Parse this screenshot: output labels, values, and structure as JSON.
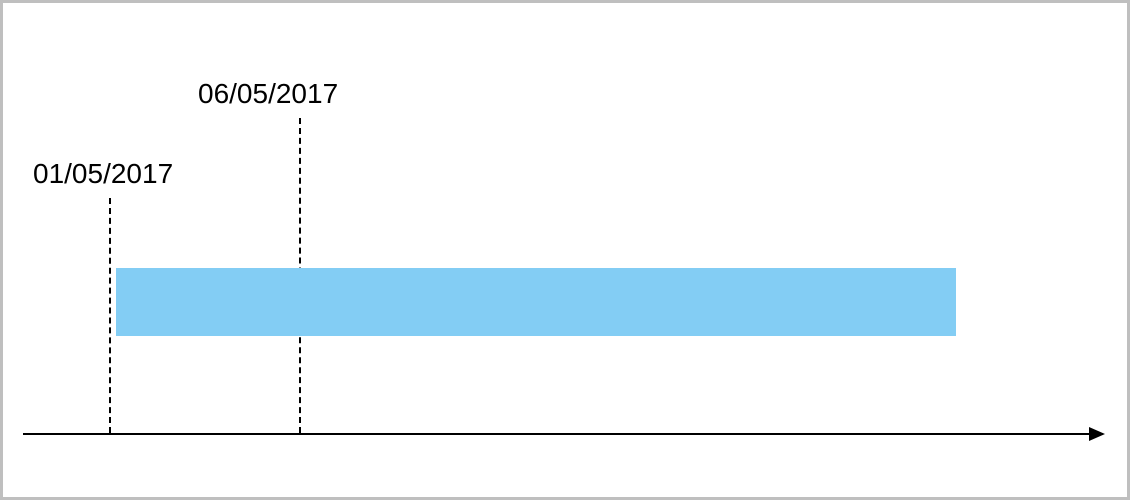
{
  "chart_data": {
    "type": "bar",
    "title": "",
    "xlabel": "",
    "ylabel": "",
    "markers": [
      {
        "label": "01/05/2017",
        "x_fraction": 0.08
      },
      {
        "label": "06/05/2017",
        "x_fraction": 0.26
      }
    ],
    "bars": [
      {
        "start_fraction": 0.087,
        "end_fraction": 0.865,
        "color": "#83cdf4"
      }
    ],
    "axis": {
      "direction": "right",
      "has_arrow": true
    }
  }
}
